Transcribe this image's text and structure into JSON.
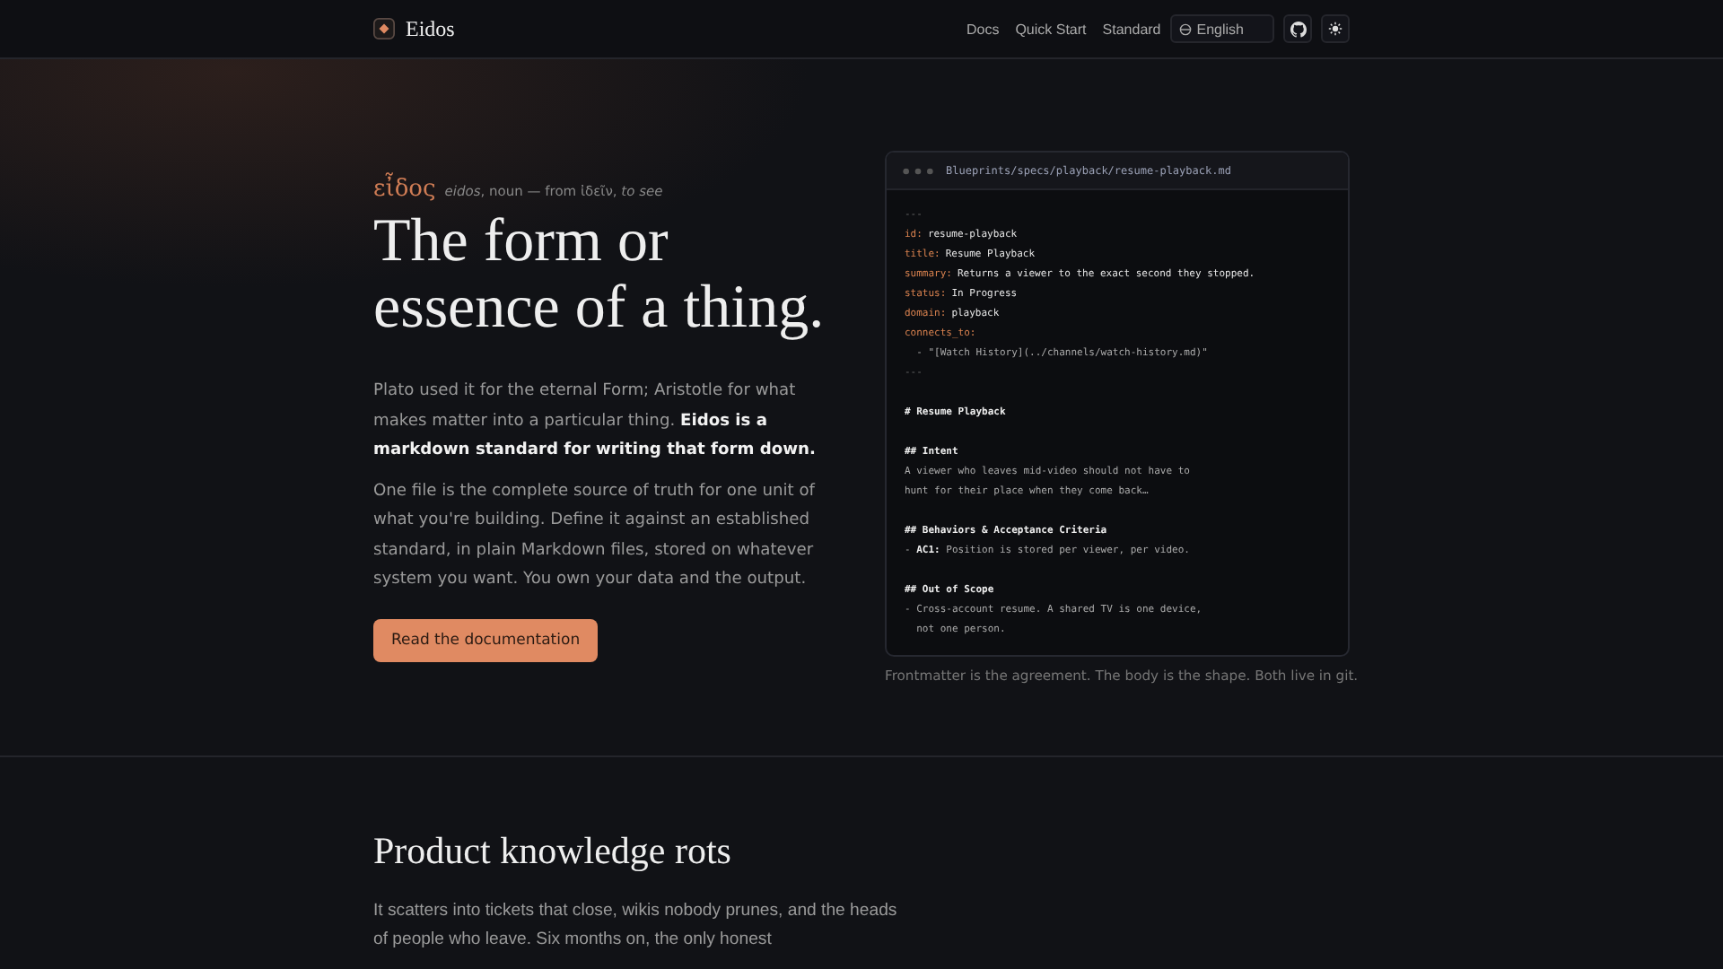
{
  "header": {
    "brand": "Eidos",
    "nav": [
      {
        "label": "Docs"
      },
      {
        "label": "Quick Start"
      },
      {
        "label": "Standard"
      }
    ],
    "language": "English"
  },
  "hero": {
    "lemma": "εἶδος",
    "definition": "*eidos*, noun — from ἰδεῖν, *to see*",
    "title_lines": [
      "The form or",
      "essence of a thing."
    ],
    "paragraphs": [
      "Plato used it for the eternal Form; Aristotle for what makes matter into a particular thing. **Eidos is a markdown standard for writing that form down.**",
      "One file is the complete source of truth for one unit of what you're building. Define it against an established standard, in plain Markdown files, stored on whatever system you want. You own your data and the output."
    ],
    "button": "Read the documentation"
  },
  "file_window": {
    "path": "Blueprints/specs/playback/resume-playback.md",
    "blocks": [
      [
        {
          "kind": "fence",
          "text": "---"
        },
        {
          "kind": "field",
          "key": "id:",
          "value": "resume-playback"
        },
        {
          "kind": "field",
          "key": "title:",
          "value": "Resume Playback"
        },
        {
          "kind": "field",
          "key": "summary:",
          "value": "Returns a viewer to the exact second they stopped."
        },
        {
          "kind": "field",
          "key": "status:",
          "value": "In Progress"
        },
        {
          "kind": "field",
          "key": "domain:",
          "value": "playback"
        },
        {
          "kind": "field",
          "key": "connects_to:"
        },
        {
          "kind": "text",
          "text": "  - \"[Watch History](../channels/watch-history.md)\""
        },
        {
          "kind": "fence",
          "text": "---"
        }
      ],
      [
        {
          "kind": "heading",
          "text": "# Resume Playback"
        }
      ],
      [
        {
          "kind": "heading",
          "text": "## Intent"
        },
        {
          "kind": "text",
          "text": "A viewer who leaves mid-video should not have to"
        },
        {
          "kind": "text",
          "text": "hunt for their place when they come back…"
        }
      ],
      [
        {
          "kind": "heading",
          "text": "## Behaviors & Acceptance Criteria"
        },
        {
          "kind": "text",
          "text": "- **AC1:** Position is stored per viewer, per video."
        }
      ],
      [
        {
          "kind": "heading",
          "text": "## Out of Scope"
        },
        {
          "kind": "text",
          "text": "- Cross-account resume. A shared TV is one device,"
        },
        {
          "kind": "text",
          "text": "  not one person."
        }
      ]
    ],
    "caption": "Frontmatter is the agreement. The body is the shape. Both live in git."
  },
  "problem": {
    "title": "Product knowledge rots",
    "paragraph": "It scatters into tickets that close, wikis nobody prunes, and the heads of people who leave. Six months on, the only honest"
  }
}
